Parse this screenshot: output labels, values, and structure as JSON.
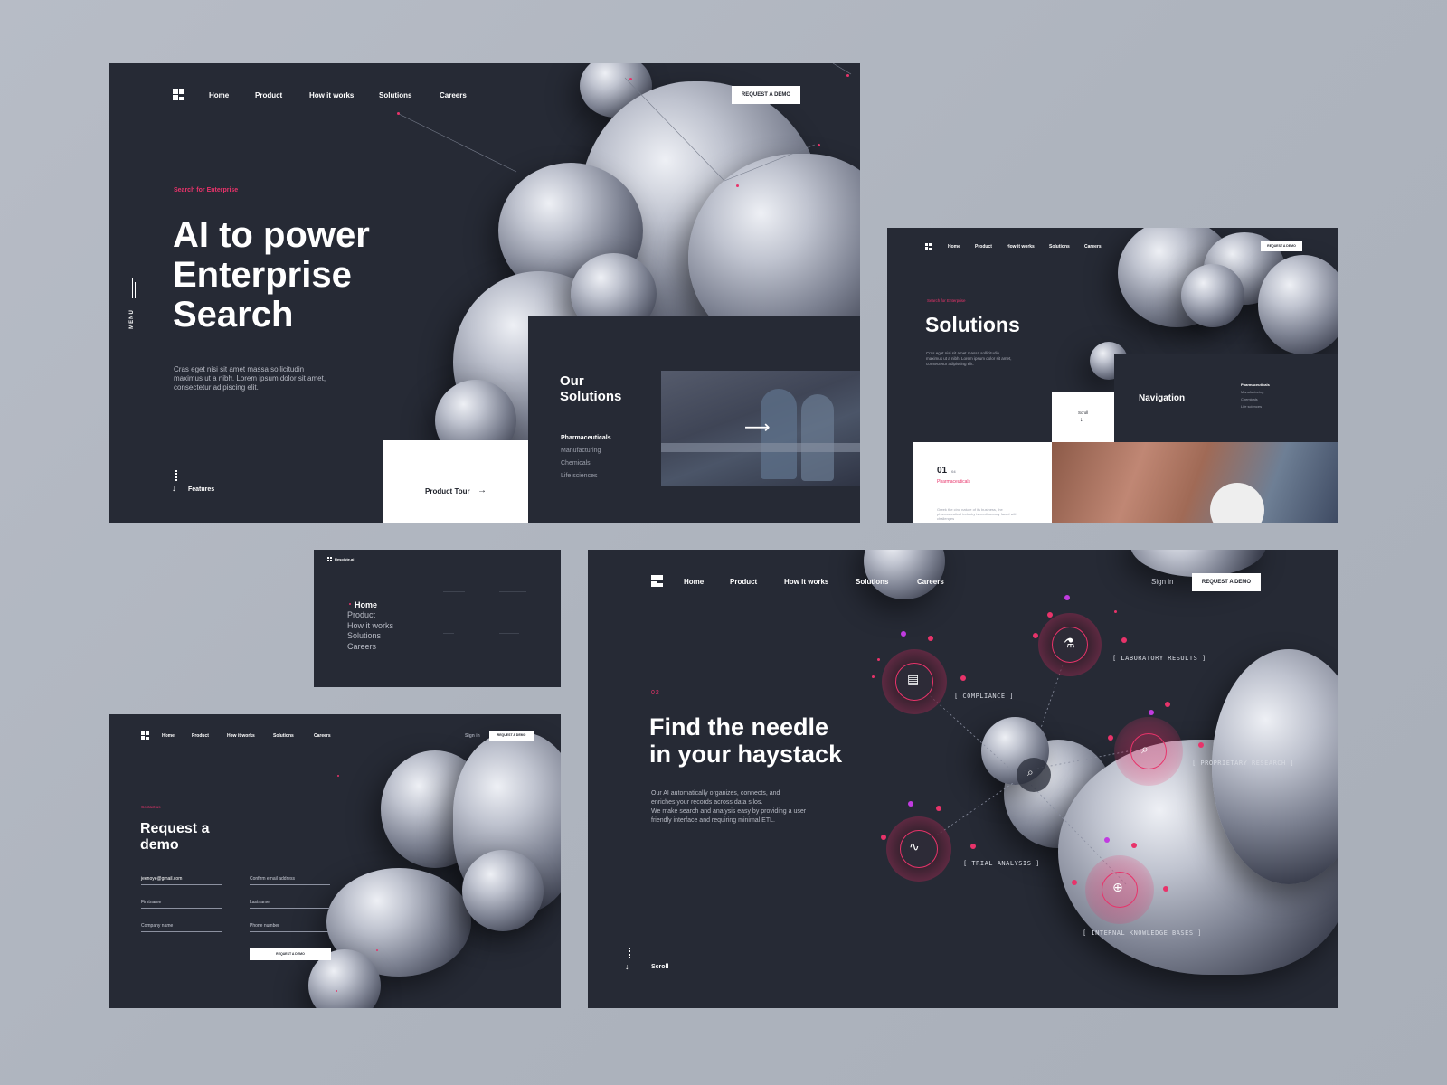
{
  "colors": {
    "accent": "#e8336a",
    "panel": "#262a35",
    "background": "#b1b7c1",
    "accent_purple": "#c13be0"
  },
  "nav": {
    "home": "Home",
    "product": "Product",
    "how": "How it works",
    "solutions": "Solutions",
    "careers": "Careers"
  },
  "hero": {
    "cta": "REQUEST A DEMO",
    "tag": "Search for Enterprise",
    "title_l1": "AI to power",
    "title_l2": "Enterprise",
    "title_l3": "Search",
    "body": "Cras eget nisi sit amet massa sollicitudin maximus ut a nibh. Lorem ipsum dolor sit amet, consectetur adipiscing elit.",
    "menu": "MENU",
    "features": "Features",
    "product_tour": "Product Tour",
    "solutions_l1": "Our",
    "solutions_l2": "Solutions",
    "list": [
      "Pharmaceuticals",
      "Manufacturing",
      "Chemicals",
      "Life sciences"
    ]
  },
  "solutions_page": {
    "cta": "REQUEST A DEMO",
    "tag": "Search for Enterprise",
    "title": "Solutions",
    "body": "Cras eget nisi sit amet massa sollicitudin maximus ut a nibh. Lorem ipsum dolor sit amet, consectetur adipiscing elit.",
    "scroll": "Scroll",
    "navigation": "Navigation",
    "nav_list": [
      "Pharmaceuticals",
      "Manufacturing",
      "Chemicals",
      "Life sciences"
    ],
    "counter": "01",
    "counter_total": "/ 04",
    "card_tag": "Pharmaceuticals",
    "card_body": "Greek the cino nature of its business, the pharmaceutical industry is continuously faced with challenges"
  },
  "menu_page": {
    "brand": "Resolute.ai",
    "items": [
      "Home",
      "Product",
      "How it works",
      "Solutions",
      "Careers"
    ]
  },
  "demo_page": {
    "signin": "Sign in",
    "cta": "REQUEST A DEMO",
    "tag": "Contact us",
    "title_l1": "Request a",
    "title_l2": "demo",
    "email_value": "jeenoye@gmail.com",
    "confirm_email": "Confirm email address",
    "firstname": "Firstname",
    "lastname": "Lastname",
    "company": "Company name",
    "phone": "Phone number",
    "submit": "REQUEST A DEMO"
  },
  "needle_page": {
    "signin": "Sign in",
    "cta": "REQUEST A DEMO",
    "number": "02",
    "title_l1": "Find the needle",
    "title_l2": "in your haystack",
    "body_l1": "Our AI automatically organizes, connects, and",
    "body_l2": "enriches your records across data silos.",
    "body_l3": "We make search and analysis easy by providing a user",
    "body_l4": "friendly interface and requiring minimal ETL.",
    "scroll": "Scroll",
    "labels": {
      "lab": "[ LABORATORY RESULTS ]",
      "compliance": "[ COMPLIANCE ]",
      "research": "[ PROPRIETARY RESEARCH ]",
      "trial": "[ TRIAL ANALYSIS ]",
      "knowledge": "[ INTERNAL KNOWLEDGE BASES ]"
    }
  }
}
